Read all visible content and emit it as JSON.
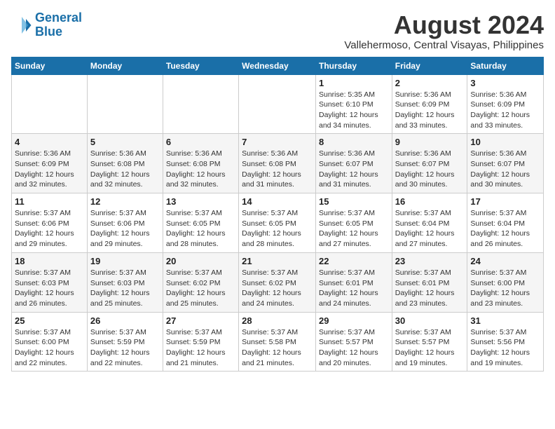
{
  "header": {
    "logo_line1": "General",
    "logo_line2": "Blue",
    "title": "August 2024",
    "subtitle": "Vallehermoso, Central Visayas, Philippines"
  },
  "days_of_week": [
    "Sunday",
    "Monday",
    "Tuesday",
    "Wednesday",
    "Thursday",
    "Friday",
    "Saturday"
  ],
  "weeks": [
    [
      {
        "day": "",
        "info": ""
      },
      {
        "day": "",
        "info": ""
      },
      {
        "day": "",
        "info": ""
      },
      {
        "day": "",
        "info": ""
      },
      {
        "day": "1",
        "info": "Sunrise: 5:35 AM\nSunset: 6:10 PM\nDaylight: 12 hours\nand 34 minutes."
      },
      {
        "day": "2",
        "info": "Sunrise: 5:36 AM\nSunset: 6:09 PM\nDaylight: 12 hours\nand 33 minutes."
      },
      {
        "day": "3",
        "info": "Sunrise: 5:36 AM\nSunset: 6:09 PM\nDaylight: 12 hours\nand 33 minutes."
      }
    ],
    [
      {
        "day": "4",
        "info": "Sunrise: 5:36 AM\nSunset: 6:09 PM\nDaylight: 12 hours\nand 32 minutes."
      },
      {
        "day": "5",
        "info": "Sunrise: 5:36 AM\nSunset: 6:08 PM\nDaylight: 12 hours\nand 32 minutes."
      },
      {
        "day": "6",
        "info": "Sunrise: 5:36 AM\nSunset: 6:08 PM\nDaylight: 12 hours\nand 32 minutes."
      },
      {
        "day": "7",
        "info": "Sunrise: 5:36 AM\nSunset: 6:08 PM\nDaylight: 12 hours\nand 31 minutes."
      },
      {
        "day": "8",
        "info": "Sunrise: 5:36 AM\nSunset: 6:07 PM\nDaylight: 12 hours\nand 31 minutes."
      },
      {
        "day": "9",
        "info": "Sunrise: 5:36 AM\nSunset: 6:07 PM\nDaylight: 12 hours\nand 30 minutes."
      },
      {
        "day": "10",
        "info": "Sunrise: 5:36 AM\nSunset: 6:07 PM\nDaylight: 12 hours\nand 30 minutes."
      }
    ],
    [
      {
        "day": "11",
        "info": "Sunrise: 5:37 AM\nSunset: 6:06 PM\nDaylight: 12 hours\nand 29 minutes."
      },
      {
        "day": "12",
        "info": "Sunrise: 5:37 AM\nSunset: 6:06 PM\nDaylight: 12 hours\nand 29 minutes."
      },
      {
        "day": "13",
        "info": "Sunrise: 5:37 AM\nSunset: 6:05 PM\nDaylight: 12 hours\nand 28 minutes."
      },
      {
        "day": "14",
        "info": "Sunrise: 5:37 AM\nSunset: 6:05 PM\nDaylight: 12 hours\nand 28 minutes."
      },
      {
        "day": "15",
        "info": "Sunrise: 5:37 AM\nSunset: 6:05 PM\nDaylight: 12 hours\nand 27 minutes."
      },
      {
        "day": "16",
        "info": "Sunrise: 5:37 AM\nSunset: 6:04 PM\nDaylight: 12 hours\nand 27 minutes."
      },
      {
        "day": "17",
        "info": "Sunrise: 5:37 AM\nSunset: 6:04 PM\nDaylight: 12 hours\nand 26 minutes."
      }
    ],
    [
      {
        "day": "18",
        "info": "Sunrise: 5:37 AM\nSunset: 6:03 PM\nDaylight: 12 hours\nand 26 minutes."
      },
      {
        "day": "19",
        "info": "Sunrise: 5:37 AM\nSunset: 6:03 PM\nDaylight: 12 hours\nand 25 minutes."
      },
      {
        "day": "20",
        "info": "Sunrise: 5:37 AM\nSunset: 6:02 PM\nDaylight: 12 hours\nand 25 minutes."
      },
      {
        "day": "21",
        "info": "Sunrise: 5:37 AM\nSunset: 6:02 PM\nDaylight: 12 hours\nand 24 minutes."
      },
      {
        "day": "22",
        "info": "Sunrise: 5:37 AM\nSunset: 6:01 PM\nDaylight: 12 hours\nand 24 minutes."
      },
      {
        "day": "23",
        "info": "Sunrise: 5:37 AM\nSunset: 6:01 PM\nDaylight: 12 hours\nand 23 minutes."
      },
      {
        "day": "24",
        "info": "Sunrise: 5:37 AM\nSunset: 6:00 PM\nDaylight: 12 hours\nand 23 minutes."
      }
    ],
    [
      {
        "day": "25",
        "info": "Sunrise: 5:37 AM\nSunset: 6:00 PM\nDaylight: 12 hours\nand 22 minutes."
      },
      {
        "day": "26",
        "info": "Sunrise: 5:37 AM\nSunset: 5:59 PM\nDaylight: 12 hours\nand 22 minutes."
      },
      {
        "day": "27",
        "info": "Sunrise: 5:37 AM\nSunset: 5:59 PM\nDaylight: 12 hours\nand 21 minutes."
      },
      {
        "day": "28",
        "info": "Sunrise: 5:37 AM\nSunset: 5:58 PM\nDaylight: 12 hours\nand 21 minutes."
      },
      {
        "day": "29",
        "info": "Sunrise: 5:37 AM\nSunset: 5:57 PM\nDaylight: 12 hours\nand 20 minutes."
      },
      {
        "day": "30",
        "info": "Sunrise: 5:37 AM\nSunset: 5:57 PM\nDaylight: 12 hours\nand 19 minutes."
      },
      {
        "day": "31",
        "info": "Sunrise: 5:37 AM\nSunset: 5:56 PM\nDaylight: 12 hours\nand 19 minutes."
      }
    ]
  ]
}
